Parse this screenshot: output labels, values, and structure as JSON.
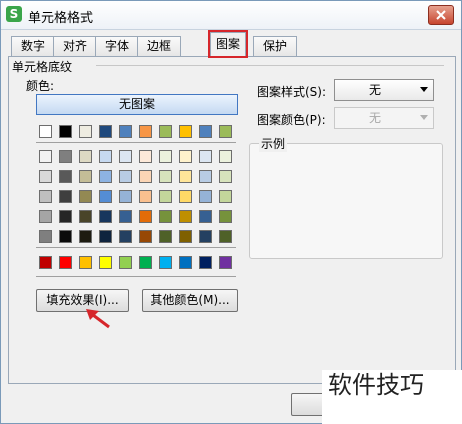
{
  "window": {
    "title": "单元格格式",
    "app_icon_letter": "S"
  },
  "tabs": [
    "数字",
    "对齐",
    "字体",
    "边框",
    "图案",
    "保护"
  ],
  "active_tab_index": 4,
  "shading": {
    "group_title": "单元格底纹",
    "color_label": "颜色:",
    "no_pattern_label": "无图案",
    "swatch_rows": [
      [
        "#ffffff",
        "#000000",
        "#eeece1",
        "#1f497d",
        "#4f81bd",
        "#f79646",
        "#9bbb59",
        "#ffc000",
        "#4f81bd",
        "#9bbb59"
      ],
      [
        "#f2f2f2",
        "#7f7f7f",
        "#ddd9c3",
        "#c6d9f0",
        "#dbe5f1",
        "#fde9d9",
        "#ebf1dd",
        "#fff2cc",
        "#dbe5f1",
        "#ebf1dd"
      ],
      [
        "#d8d8d8",
        "#595959",
        "#c4bd97",
        "#8db3e2",
        "#b8cce4",
        "#fbd5b5",
        "#d7e3bc",
        "#ffe599",
        "#b8cce4",
        "#d7e3bc"
      ],
      [
        "#bfbfbf",
        "#3f3f3f",
        "#938953",
        "#548dd4",
        "#95b3d7",
        "#fac08f",
        "#c3d69b",
        "#ffd966",
        "#95b3d7",
        "#c3d69b"
      ],
      [
        "#a5a5a5",
        "#262626",
        "#494429",
        "#17365d",
        "#366092",
        "#e36c09",
        "#76923c",
        "#bf8f00",
        "#366092",
        "#76923c"
      ],
      [
        "#7f7f7f",
        "#0c0c0c",
        "#1d1b10",
        "#0f243e",
        "#244061",
        "#974806",
        "#4f6128",
        "#7f6000",
        "#244061",
        "#4f6128"
      ]
    ],
    "standard_colors": [
      "#c00000",
      "#ff0000",
      "#ffc000",
      "#ffff00",
      "#92d050",
      "#00b050",
      "#00b0f0",
      "#0070c0",
      "#002060",
      "#7030a0"
    ],
    "fill_effects_label": "填充效果(I)...",
    "more_colors_label": "其他颜色(M)..."
  },
  "pattern": {
    "style_label": "图案样式(S):",
    "style_value": "无",
    "color_label": "图案颜色(P):",
    "color_value": "无"
  },
  "example": {
    "label": "示例"
  },
  "footer": {
    "ok_label": "确"
  },
  "watermark": "软件技巧",
  "colors": {
    "active_tab_outline": "#d6262b",
    "arrow": "#d6262b",
    "title_bar": "#eef2f7"
  }
}
